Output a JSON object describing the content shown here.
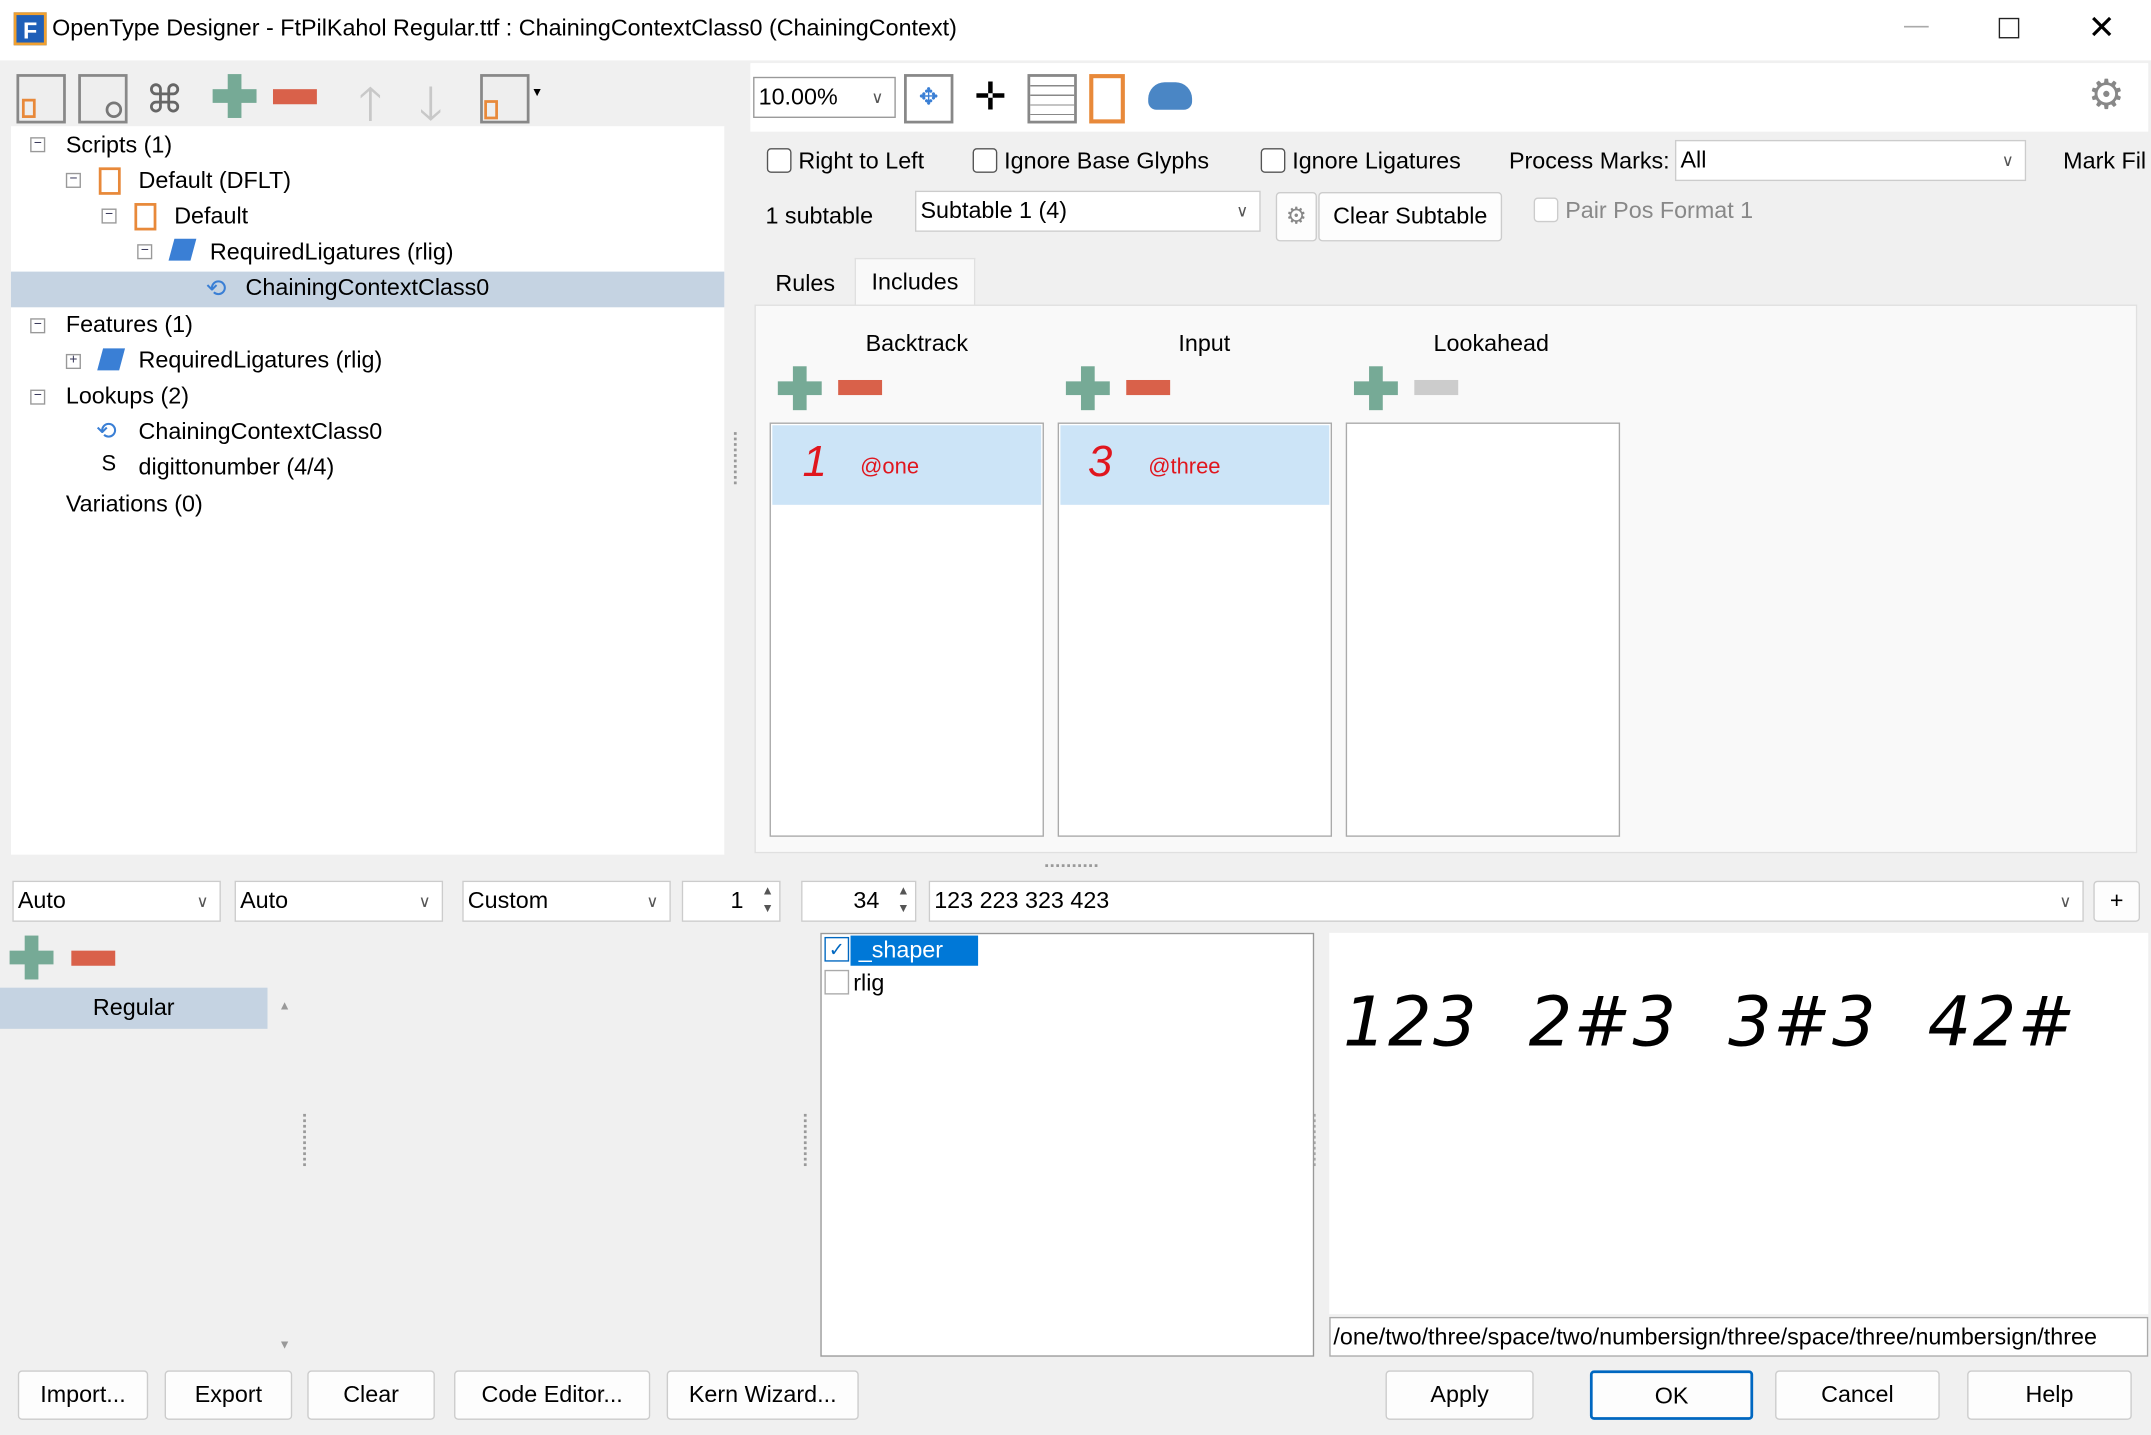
{
  "window": {
    "title": "OpenType Designer - FtPilKahol Regular.ttf : ChainingContextClass0 (ChainingContext)",
    "app_icon": "F"
  },
  "tree": {
    "items": [
      {
        "label": "Scripts (1)",
        "icon": "none"
      },
      {
        "label": "Default (DFLT)",
        "icon": "script-icon"
      },
      {
        "label": "Default",
        "icon": "language-icon"
      },
      {
        "label": "RequiredLigatures (rlig)",
        "icon": "feature-icon"
      },
      {
        "label": "ChainingContextClass0",
        "icon": "chain-lookup-icon",
        "selected": true
      },
      {
        "label": "Features (1)",
        "icon": "none"
      },
      {
        "label": "RequiredLigatures (rlig)",
        "icon": "feature-icon"
      },
      {
        "label": "Lookups (2)",
        "icon": "none"
      },
      {
        "label": "ChainingContextClass0",
        "icon": "chain-lookup-icon"
      },
      {
        "label": "digittonumber (4/4)",
        "icon": "single-lookup-icon",
        "glyph": "S"
      },
      {
        "label": "Variations (0)",
        "icon": "none"
      }
    ]
  },
  "toolbar": {
    "zoom": "10.00%"
  },
  "options": {
    "right_to_left": "Right to Left",
    "ignore_base": "Ignore Base Glyphs",
    "ignore_lig": "Ignore Ligatures",
    "process_marks_label": "Process Marks:",
    "process_marks_value": "All",
    "mark_filter": "Mark Fil",
    "subtable_count": "1 subtable",
    "subtable_value": "Subtable 1 (4)",
    "clear_subtable": "Clear Subtable",
    "pair_pos": "Pair Pos Format 1"
  },
  "tabs": [
    {
      "label": "Rules"
    },
    {
      "label": "Includes",
      "active": true
    }
  ],
  "columns": [
    {
      "title": "Backtrack",
      "items": [
        {
          "glyph": "1",
          "name": "@one"
        }
      ]
    },
    {
      "title": "Input",
      "items": [
        {
          "glyph": "3",
          "name": "@three"
        }
      ]
    },
    {
      "title": "Lookahead",
      "items": []
    }
  ],
  "bottom": {
    "combo1": "Auto",
    "combo2": "Auto",
    "combo3": "Custom",
    "spin1": "1",
    "spin2": "34",
    "text": "123 223 323 423",
    "plus_label": "+",
    "styles": [
      "Regular"
    ],
    "features": [
      {
        "label": "_shaper",
        "checked": true
      },
      {
        "label": "rlig",
        "checked": false
      }
    ],
    "preview_text": "123 2#3 3#3 42#",
    "glyph_path": "/one/two/three/space/two/numbersign/three/space/three/numbersign/three"
  },
  "buttons": {
    "import": "Import...",
    "export": "Export",
    "clear": "Clear",
    "code_editor": "Code Editor...",
    "kern_wizard": "Kern Wizard...",
    "apply": "Apply",
    "ok": "OK",
    "cancel": "Cancel",
    "help": "Help"
  },
  "colors": {
    "accent_add": "#76aa96",
    "accent_remove": "#d9614a",
    "selection": "#cce4f7",
    "tree_selection": "#c5d3e2"
  }
}
